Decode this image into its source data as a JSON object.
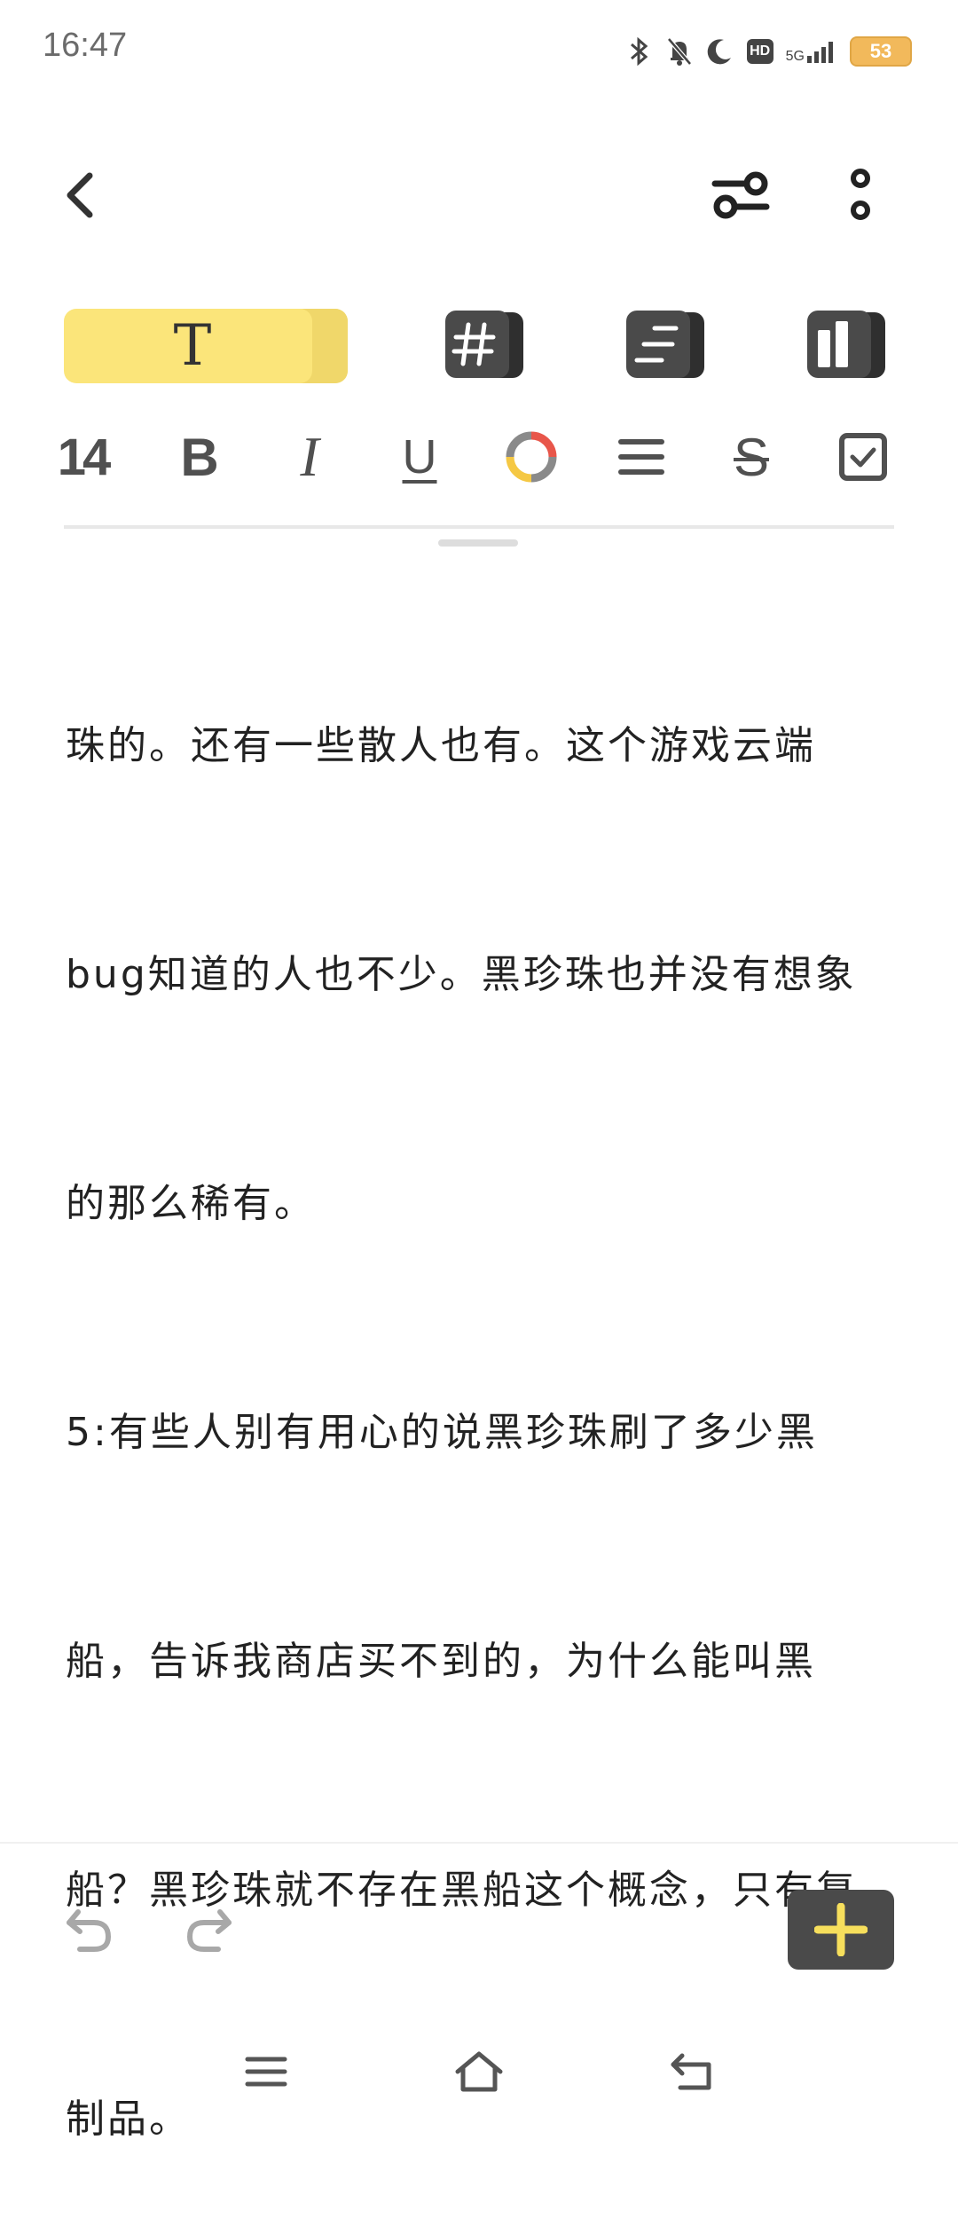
{
  "status_bar": {
    "time": "16:47",
    "network": "5G",
    "hd": "HD",
    "battery": "53",
    "icons": [
      "bluetooth-icon",
      "mute-bell-icon",
      "moon-icon",
      "hd-icon",
      "signal-icon",
      "battery-icon"
    ]
  },
  "app_bar": {
    "icons": [
      "back-icon",
      "sliders-icon",
      "more-vertical-icon"
    ]
  },
  "style_chips": {
    "text_style_label": "T",
    "icons": [
      "text-style-icon",
      "hash-tag-icon",
      "heading-list-icon",
      "layout-columns-icon"
    ]
  },
  "format_toolbar": {
    "font_size": "14",
    "bold_label": "B",
    "italic_label": "I",
    "underline_label": "U",
    "strike_label": "S",
    "icons": [
      "color-ring-icon",
      "align-icon",
      "checkbox-icon"
    ],
    "colors": {
      "ring_red": "#e8564a",
      "ring_yellow": "#f5c844",
      "ring_gray": "#8a8a8a"
    }
  },
  "note": {
    "lines": [
      "珠的。还有一些散人也有。这个游戏云端",
      "bug知道的人也不少。黑珍珠也并没有想象",
      "的那么稀有。",
      "5:有些人别有用心的说黑珍珠刷了多少黑",
      "船，告诉我商店买不到的，为什么能叫黑",
      "船？黑珍珠就不存在黑船这个概念，只有复",
      "制品。"
    ]
  },
  "bottom_bar": {
    "icons": [
      "undo-icon",
      "redo-icon",
      "add-icon"
    ],
    "accent": "#f7df5c"
  },
  "nav_bar": {
    "icons": [
      "menu-icon",
      "home-icon",
      "back-nav-icon"
    ]
  }
}
